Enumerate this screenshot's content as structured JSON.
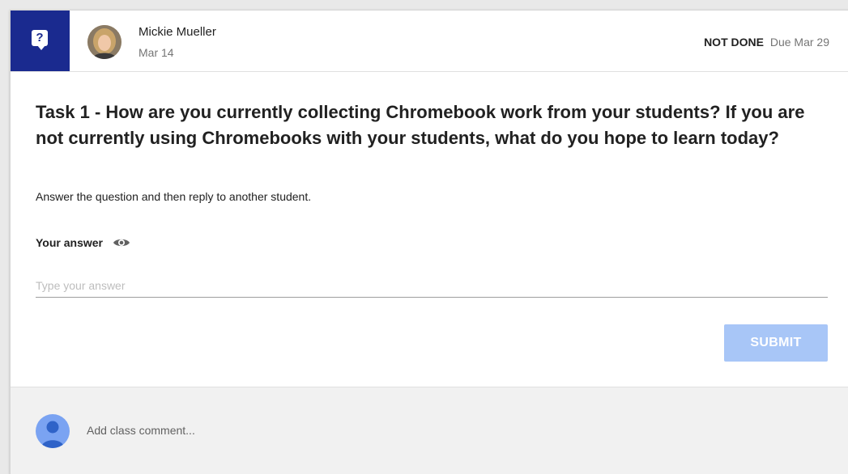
{
  "post": {
    "author": "Mickie Mueller",
    "date": "Mar 14",
    "status": "NOT DONE",
    "due": "Due Mar 29",
    "title": "Task 1 - How are you currently collecting Chromebook work from your students? If you are not currently using Chromebooks with your students, what do you hope to learn today?",
    "instructions": "Answer the question and then reply to another student."
  },
  "answer": {
    "label": "Your answer",
    "placeholder": "Type your answer",
    "value": "",
    "submit_label": "SUBMIT"
  },
  "comment": {
    "placeholder": "Add class comment..."
  },
  "icons": {
    "badge": "question-icon",
    "visibility": "eye-icon",
    "user": "person-icon"
  },
  "colors": {
    "badge": "#1a2a8f",
    "submit_disabled": "#a8c6f7",
    "comment_avatar": "#7aa3f2"
  }
}
